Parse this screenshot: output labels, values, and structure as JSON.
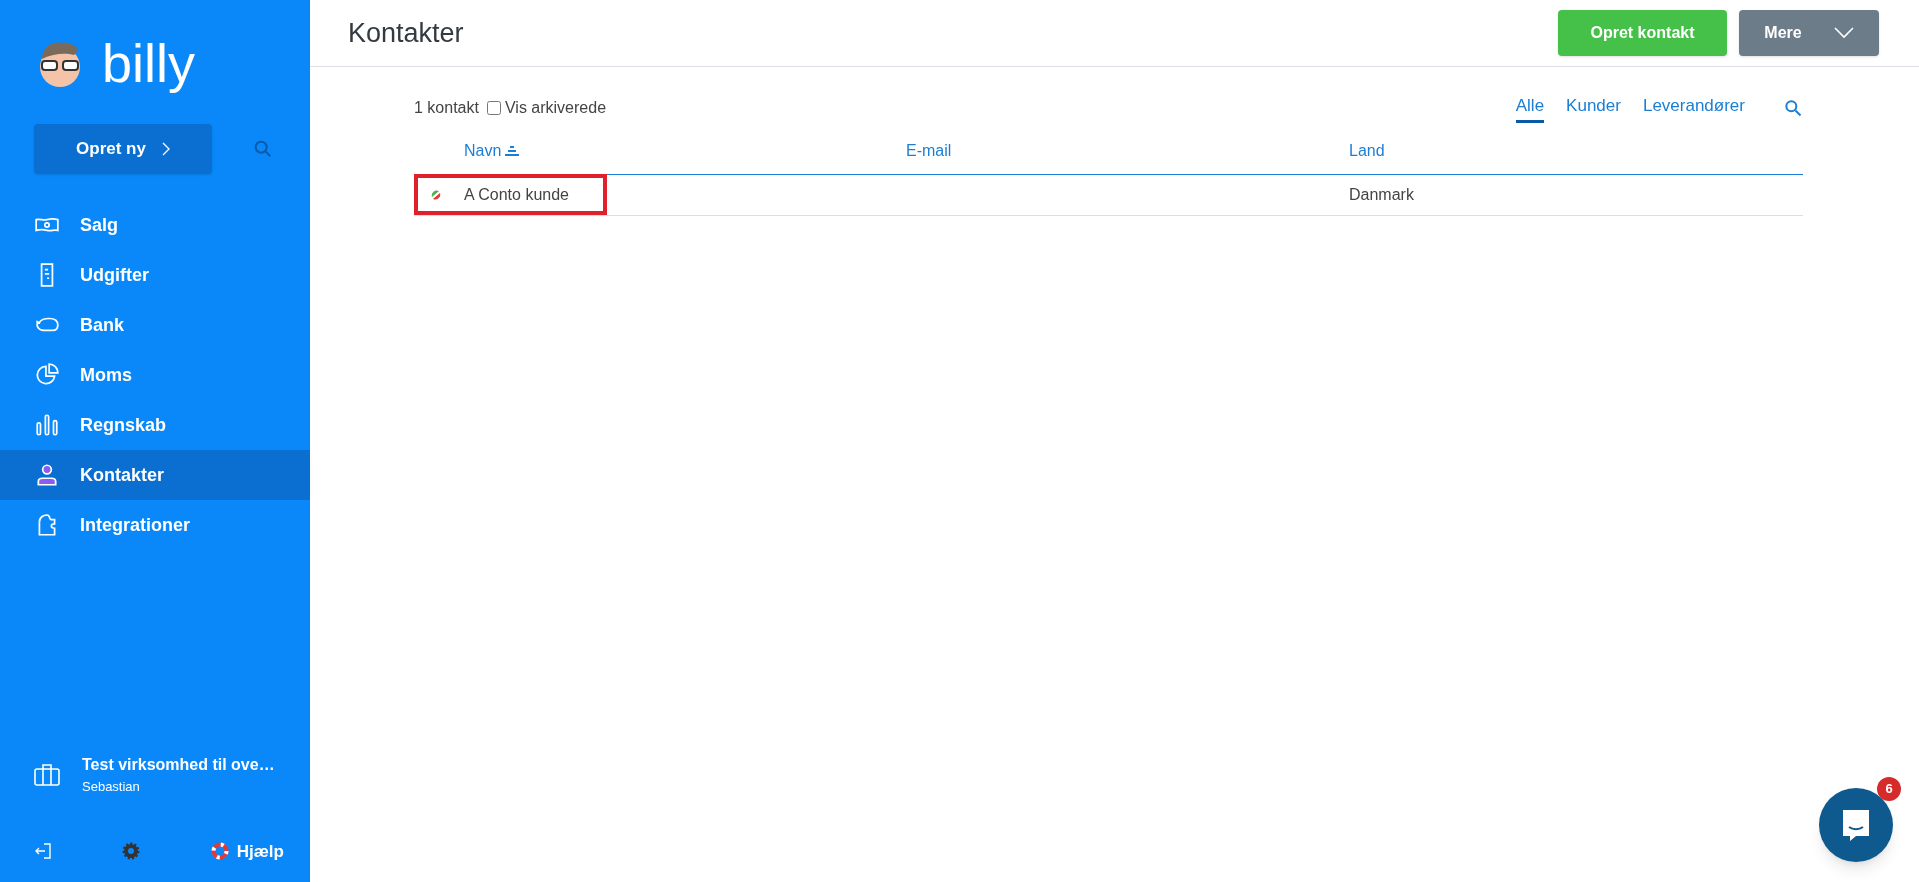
{
  "sidebar": {
    "logo": "billy",
    "create_button": "Opret ny",
    "items": [
      {
        "label": "Salg",
        "kind": "money",
        "selected": false
      },
      {
        "label": "Udgifter",
        "kind": "receipt",
        "selected": false
      },
      {
        "label": "Bank",
        "kind": "piggy",
        "selected": false
      },
      {
        "label": "Moms",
        "kind": "pie",
        "selected": false
      },
      {
        "label": "Regnskab",
        "kind": "bars",
        "selected": false
      },
      {
        "label": "Kontakter",
        "kind": "person",
        "selected": true
      },
      {
        "label": "Integrationer",
        "kind": "puzzle",
        "selected": false
      }
    ],
    "account": {
      "company": "Test virksomhed til ove…",
      "user": "Sebastian"
    },
    "help": "Hjælp"
  },
  "header": {
    "title": "Kontakter",
    "primary_button": "Opret kontakt",
    "more_button": "Mere"
  },
  "toolbar": {
    "count": "1 kontakt",
    "archived": {
      "label": "Vis arkiverede",
      "checked": false
    },
    "filters": [
      {
        "label": "Alle",
        "selected": true
      },
      {
        "label": "Kunder",
        "selected": false
      },
      {
        "label": "Leverandører",
        "selected": false
      }
    ]
  },
  "table": {
    "columns": [
      {
        "label": "Navn",
        "sorted": true
      },
      {
        "label": "E-mail",
        "sorted": false
      },
      {
        "label": "Land",
        "sorted": false
      }
    ],
    "rows": [
      {
        "name": "A Conto kunde",
        "country": "Danmark",
        "highlighted": true
      }
    ]
  },
  "chat": {
    "badge": "6"
  }
}
